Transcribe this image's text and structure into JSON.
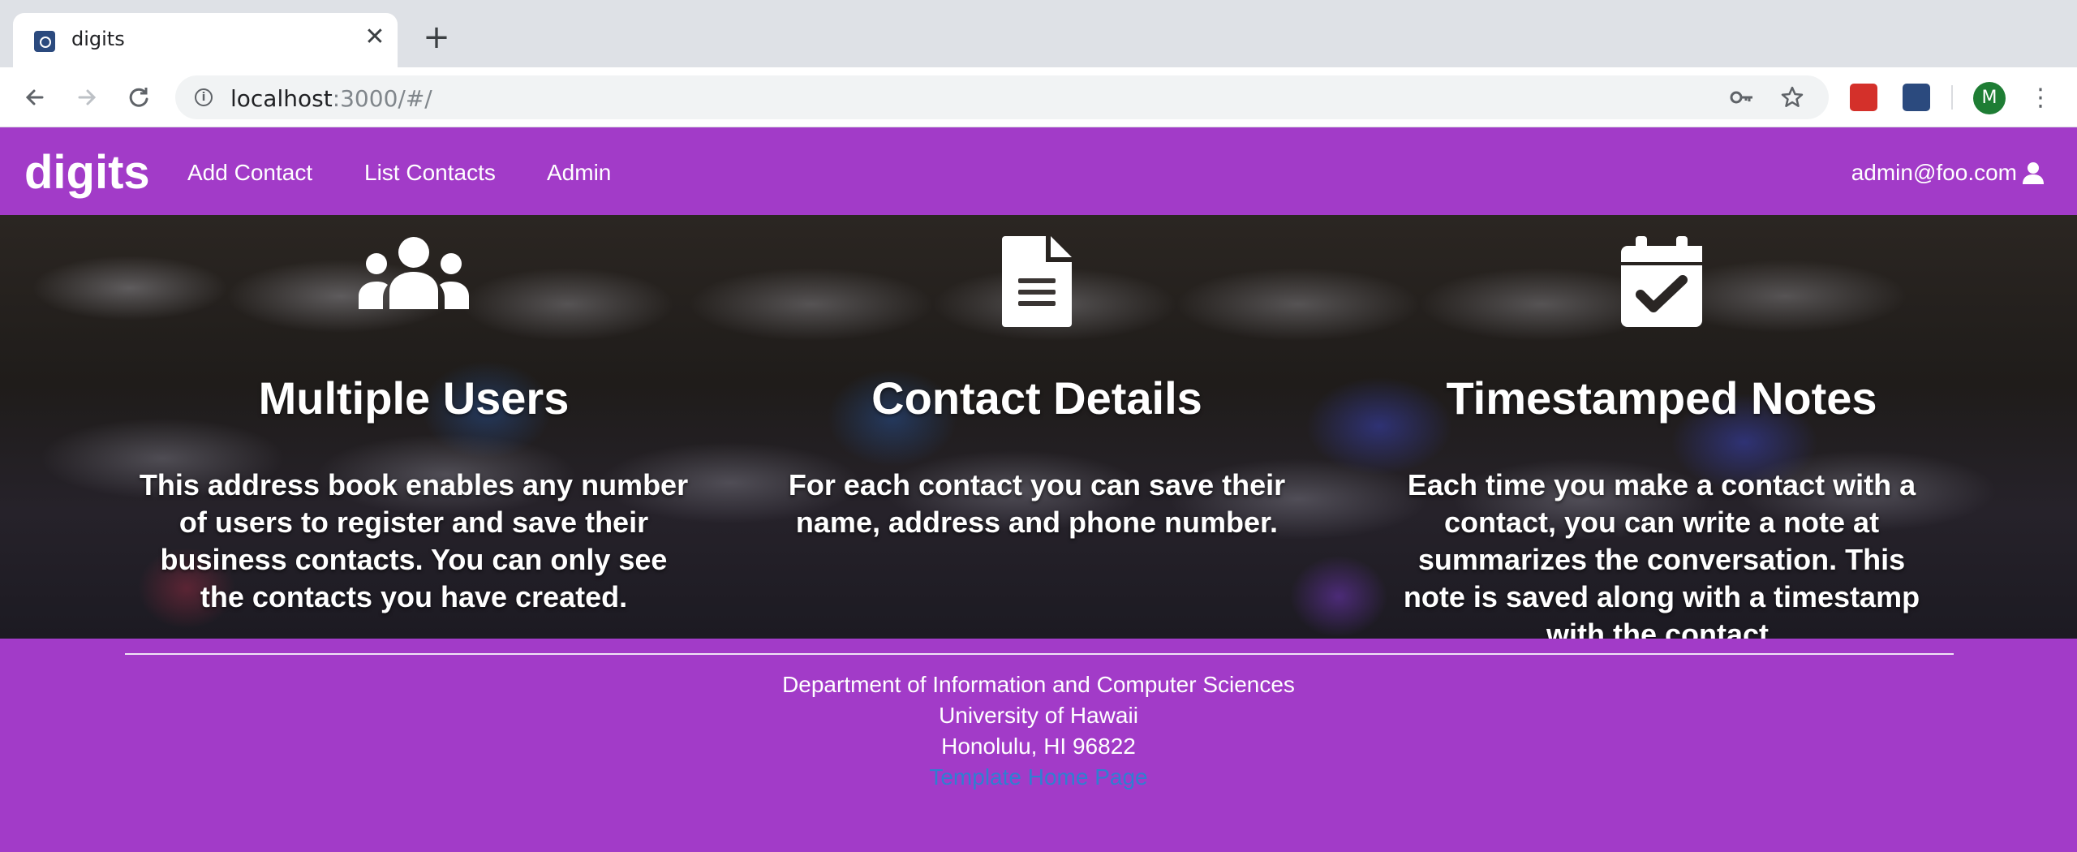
{
  "browser": {
    "tab_title": "digits",
    "tab_close": "✕",
    "new_tab": "+",
    "url_host": "localhost",
    "url_rest": ":3000/#/",
    "profile_initial": "M"
  },
  "navbar": {
    "brand": "digits",
    "links": [
      "Add Contact",
      "List Contacts",
      "Admin"
    ],
    "user": "admin@foo.com"
  },
  "features": [
    {
      "icon": "users-icon",
      "title": "Multiple Users",
      "text": "This address book enables any number of users to register and save their business contacts. You can only see the contacts you have created."
    },
    {
      "icon": "file-icon",
      "title": "Contact Details",
      "text": "For each contact you can save their name, address and phone number."
    },
    {
      "icon": "calendar-check-icon",
      "title": "Timestamped Notes",
      "text": "Each time you make a contact with a contact, you can write a note at summarizes the conversation. This note is saved along with a timestamp with the contact."
    }
  ],
  "footer": {
    "department": "Department of Information and Computer Sciences",
    "university": "University of Hawaii",
    "address": "Honolulu, HI 96822",
    "link": "Template Home Page"
  },
  "colors": {
    "brand_purple": "#a23bc8",
    "link_blue": "#2f7fd1"
  }
}
